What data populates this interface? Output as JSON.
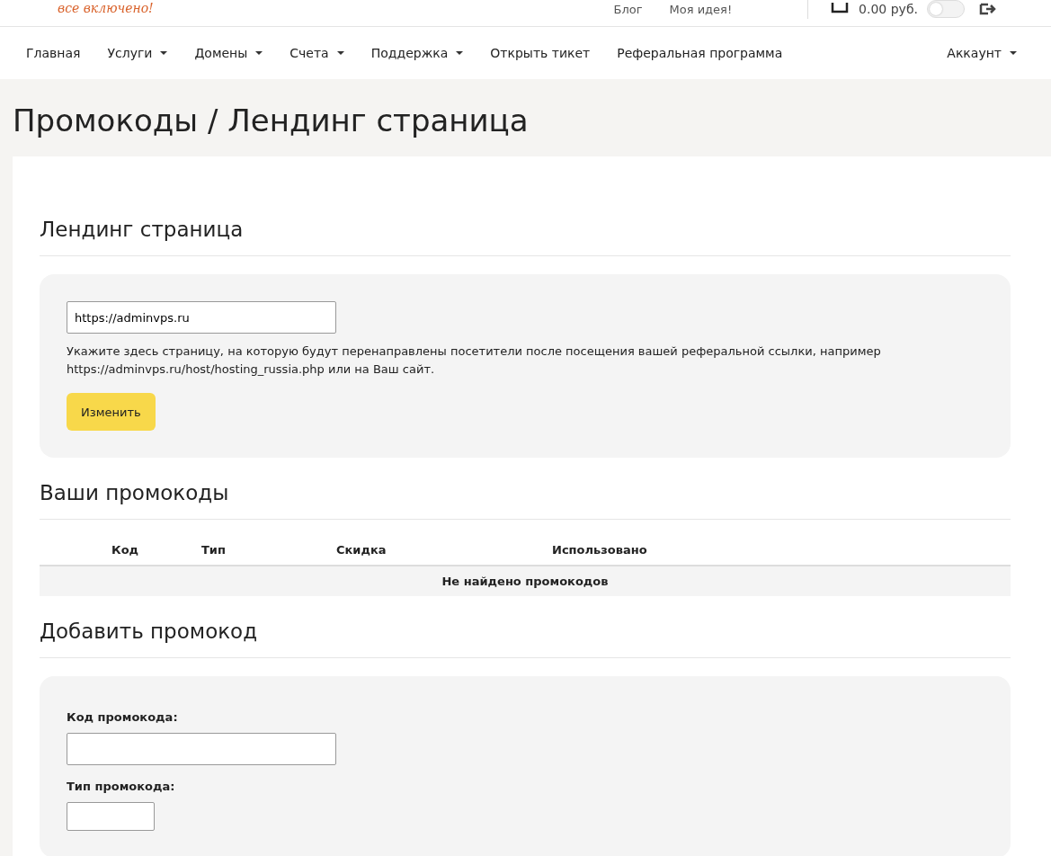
{
  "header": {
    "logo_tagline": "все включено!",
    "top_links": [
      "Блог",
      "Моя идея!"
    ],
    "balance": "0.00 руб.",
    "theme_switch": {
      "on": false
    }
  },
  "nav": {
    "items": [
      {
        "label": "Главная",
        "dropdown": false
      },
      {
        "label": "Услуги",
        "dropdown": true
      },
      {
        "label": "Домены",
        "dropdown": true
      },
      {
        "label": "Счета",
        "dropdown": true
      },
      {
        "label": "Поддержка",
        "dropdown": true
      },
      {
        "label": "Открыть тикет",
        "dropdown": false
      },
      {
        "label": "Реферальная программа",
        "dropdown": false
      }
    ],
    "account": {
      "label": "Аккаунт",
      "dropdown": true
    }
  },
  "page_title": "Промокоды / Лендинг страница",
  "landing": {
    "heading": "Лендинг страница",
    "url_value": "https://adminvps.ru",
    "help": "Укажите здесь страницу, на которую будут перенаправлены посетители после посещения вашей реферальной ссылки, например https://adminvps.ru/host/hosting_russia.php или на Ваш сайт.",
    "button": "Изменить"
  },
  "promocodes": {
    "heading": "Ваши промокоды",
    "columns": [
      "Код",
      "Тип",
      "Скидка",
      "Использовано"
    ],
    "empty": "Не найдено промокодов"
  },
  "add": {
    "heading": "Добавить промокод",
    "fields": [
      {
        "label": "Код промокода:",
        "kind": "text"
      },
      {
        "label": "Тип промокода:",
        "kind": "select"
      }
    ]
  }
}
